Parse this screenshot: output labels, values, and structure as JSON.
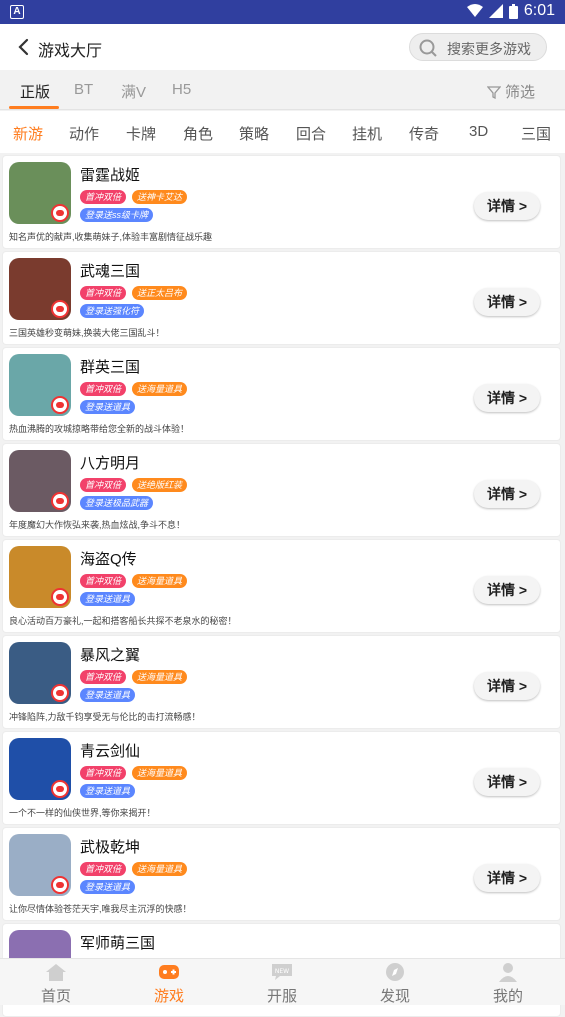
{
  "status_bar": {
    "time": "6:01"
  },
  "header": {
    "back_icon": "back-arrow-icon",
    "title": "游戏大厅",
    "search_placeholder": "搜索更多游戏"
  },
  "platform_tabs": {
    "items": [
      "正版",
      "BT",
      "满V",
      "H5"
    ],
    "active": "正版",
    "filter_label": "筛选"
  },
  "category_tabs": {
    "items": [
      "新游",
      "动作",
      "卡牌",
      "角色",
      "策略",
      "回合",
      "挂机",
      "传奇",
      "3D",
      "三国"
    ],
    "active": "新游"
  },
  "games": [
    {
      "name": "雷霆战姬",
      "tags": [
        "首冲双倍",
        "送神卡艾达",
        "登录送ss级卡牌"
      ],
      "desc": "知名声优的献声,收集萌妹子,体验丰富剧情征战乐趣",
      "detail": "详情 >",
      "art": "#6a8f5a"
    },
    {
      "name": "武魂三国",
      "tags": [
        "首冲双倍",
        "送正太吕布",
        "登录送强化符"
      ],
      "desc": "三国英雄秒变萌妹,换装大佬三国乱斗！",
      "detail": "详情 >",
      "art": "#7a3b2e"
    },
    {
      "name": "群英三国",
      "tags": [
        "首冲双倍",
        "送海量道具",
        "登录送道具"
      ],
      "desc": "热血沸腾的攻城掠略带给您全新的战斗体验！",
      "detail": "详情 >",
      "art": "#6aa7a8"
    },
    {
      "name": "八方明月",
      "tags": [
        "首冲双倍",
        "送绝版红装",
        "登录送极品武器"
      ],
      "desc": "年度魔幻大作恢弘来袭,热血炫战,争斗不息！",
      "detail": "详情 >",
      "art": "#6b5a63"
    },
    {
      "name": "海盗Q传",
      "tags": [
        "首冲双倍",
        "送海量道具",
        "登录送道具"
      ],
      "desc": "良心活动百万豪礼,一起和搭客船长共探不老泉水的秘密！",
      "detail": "详情 >",
      "art": "#c98a2a"
    },
    {
      "name": "暴风之翼",
      "tags": [
        "首冲双倍",
        "送海量道具",
        "登录送道具"
      ],
      "desc": "冲锋陷阵,力敌千钧享受无与伦比的击打流畅感！",
      "detail": "详情 >",
      "art": "#3a5c84"
    },
    {
      "name": "青云剑仙",
      "tags": [
        "首冲双倍",
        "送海量道具",
        "登录送道具"
      ],
      "desc": "一个不一样的仙侠世界,等你来揭开！",
      "detail": "详情 >",
      "art": "#1f4fa8"
    },
    {
      "name": "武极乾坤",
      "tags": [
        "首冲双倍",
        "送海量道具",
        "登录送道具"
      ],
      "desc": "让你尽情体验苍茫天宇,唯我尽主沉浮的快感！",
      "detail": "详情 >",
      "art": "#9aaec6"
    },
    {
      "name": "军师萌三国",
      "tags": [],
      "desc": "",
      "detail": "",
      "art": "#8b6fb1"
    }
  ],
  "bottom_nav": {
    "items": [
      {
        "label": "首页",
        "icon": "home-icon"
      },
      {
        "label": "游戏",
        "icon": "gamepad-icon"
      },
      {
        "label": "开服",
        "icon": "new-server-icon",
        "badge": "NEW"
      },
      {
        "label": "发现",
        "icon": "compass-icon"
      },
      {
        "label": "我的",
        "icon": "user-icon"
      }
    ],
    "active": "游戏"
  },
  "colors": {
    "accent": "#ff7d1f",
    "status_bar": "#303f9f",
    "tag_red": "#f2416a",
    "tag_orange": "#ff8a1d",
    "tag_blue": "#5b86ff"
  }
}
